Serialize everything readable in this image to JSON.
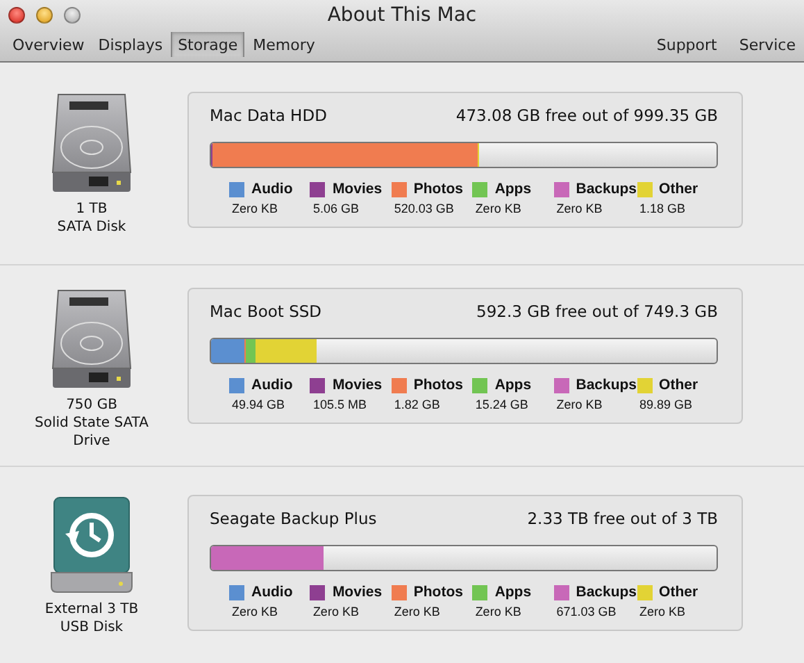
{
  "window": {
    "title": "About This Mac"
  },
  "tabs": [
    {
      "label": "Overview",
      "selected": false
    },
    {
      "label": "Displays",
      "selected": false
    },
    {
      "label": "Storage",
      "selected": true
    },
    {
      "label": "Memory",
      "selected": false
    }
  ],
  "links": [
    "Support",
    "Service"
  ],
  "disks": [
    {
      "kind": "hdd",
      "capacity": "1 TB",
      "type": "SATA Disk",
      "name": "Mac Data HDD",
      "free": "473.08 GB free out of 999.35 GB",
      "usage_bar": [
        {
          "color": "#8e3f91",
          "level": 0.003
        },
        {
          "color": "#f07c50",
          "level": 0.525
        },
        {
          "color": "#e2d335",
          "level": 0.002
        }
      ],
      "categories": [
        {
          "label": "Audio",
          "size": "Zero KB",
          "color": "#5b8fd0"
        },
        {
          "label": "Movies",
          "size": "5.06 GB",
          "color": "#8e3f91"
        },
        {
          "label": "Photos",
          "size": "520.03 GB",
          "color": "#f07c50"
        },
        {
          "label": "Apps",
          "size": "Zero KB",
          "color": "#72c553"
        },
        {
          "label": "Backups",
          "size": "Zero KB",
          "color": "#c868b8"
        },
        {
          "label": "Other",
          "size": "1.18 GB",
          "color": "#e2d335"
        }
      ]
    },
    {
      "kind": "hdd",
      "capacity": "750 GB",
      "type": "Solid State SATA Drive",
      "name": "Mac Boot SSD",
      "free": "592.3 GB free out of 749.3 GB",
      "usage_bar": [
        {
          "color": "#5b8fd0",
          "level": 0.065
        },
        {
          "color": "#f07c50",
          "level": 0.003
        },
        {
          "color": "#72c553",
          "level": 0.02
        },
        {
          "color": "#e2d335",
          "level": 0.12
        }
      ],
      "categories": [
        {
          "label": "Audio",
          "size": "49.94 GB",
          "color": "#5b8fd0"
        },
        {
          "label": "Movies",
          "size": "105.5 MB",
          "color": "#8e3f91"
        },
        {
          "label": "Photos",
          "size": "1.82 GB",
          "color": "#f07c50"
        },
        {
          "label": "Apps",
          "size": "15.24 GB",
          "color": "#72c553"
        },
        {
          "label": "Backups",
          "size": "Zero KB",
          "color": "#c868b8"
        },
        {
          "label": "Other",
          "size": "89.89 GB",
          "color": "#e2d335"
        }
      ]
    },
    {
      "kind": "external",
      "capacity": "External 3 TB",
      "type": "USB Disk",
      "name": "Seagate Backup Plus",
      "free": "2.33 TB free out of 3 TB",
      "usage_bar": [
        {
          "color": "#c868b8",
          "level": 0.223
        }
      ],
      "categories": [
        {
          "label": "Audio",
          "size": "Zero KB",
          "color": "#5b8fd0"
        },
        {
          "label": "Movies",
          "size": "Zero KB",
          "color": "#8e3f91"
        },
        {
          "label": "Photos",
          "size": "Zero KB",
          "color": "#f07c50"
        },
        {
          "label": "Apps",
          "size": "Zero KB",
          "color": "#72c553"
        },
        {
          "label": "Backups",
          "size": "671.03 GB",
          "color": "#c868b8"
        },
        {
          "label": "Other",
          "size": "Zero KB",
          "color": "#e2d335"
        }
      ]
    }
  ]
}
